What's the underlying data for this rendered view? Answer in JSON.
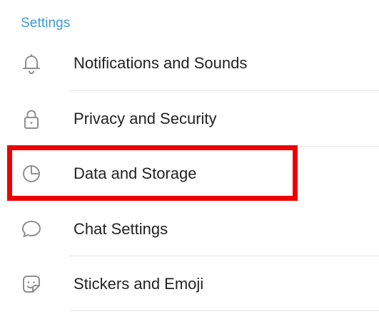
{
  "section": {
    "title": "Settings"
  },
  "items": [
    {
      "label": "Notifications and Sounds",
      "icon": "bell-icon"
    },
    {
      "label": "Privacy and Security",
      "icon": "lock-icon"
    },
    {
      "label": "Data and Storage",
      "icon": "pie-chart-icon"
    },
    {
      "label": "Chat Settings",
      "icon": "chat-bubble-icon"
    },
    {
      "label": "Stickers and Emoji",
      "icon": "sticker-icon"
    }
  ],
  "colors": {
    "section_title": "#3d9ad6",
    "icon": "#8e8e93",
    "text": "#222222",
    "highlight": "#ee0000",
    "divider": "#e4e4e4"
  }
}
